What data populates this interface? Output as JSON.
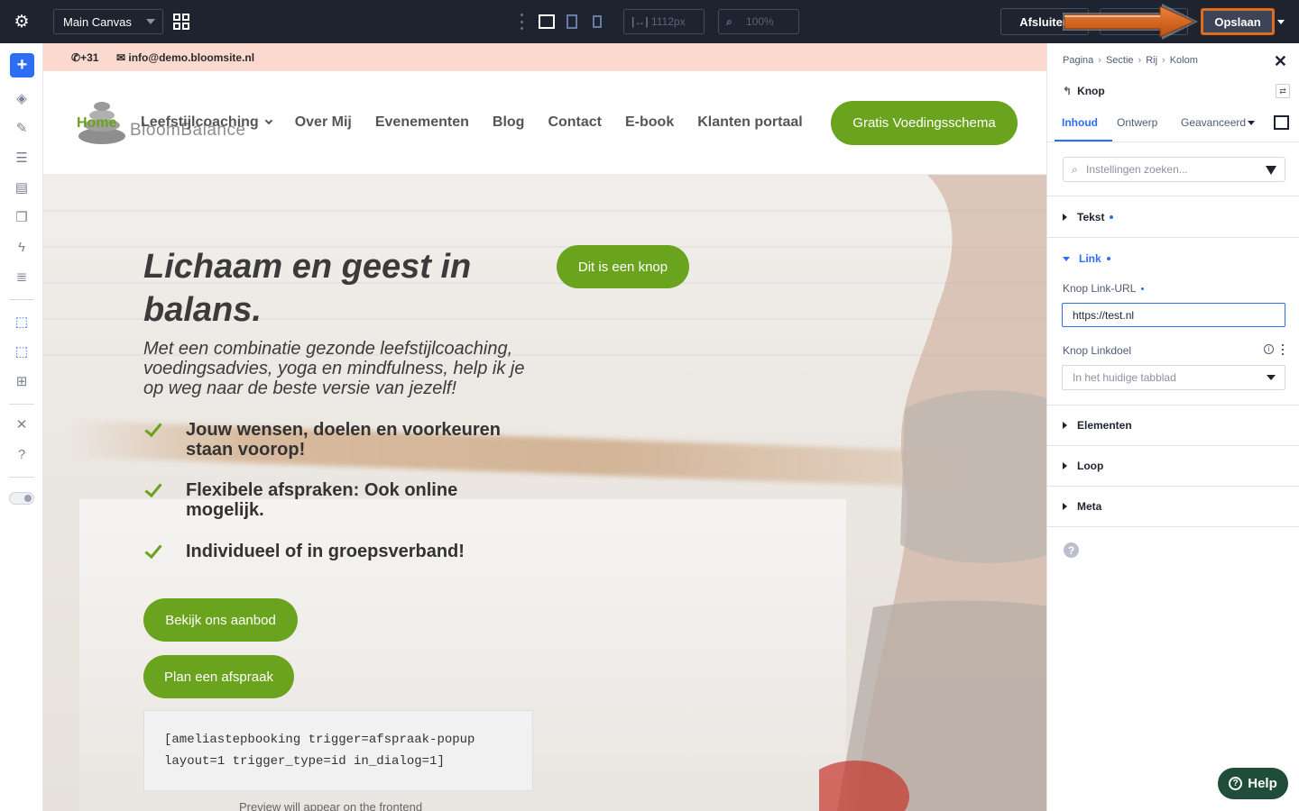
{
  "topbar": {
    "canvas_select": "Main Canvas",
    "width_value": "1112px",
    "zoom_value": "100%",
    "afsluiten_label": "Afsluiten",
    "voorbeeld_label": "Voorbeeld",
    "opslaan_label": "Opslaan",
    "highlight_color": "#e36c1b"
  },
  "leftbar": {
    "icons": [
      "add-icon",
      "layers-icon",
      "brush-icon",
      "database-icon",
      "form-icon",
      "pages-icon",
      "lightning-icon",
      "template-icon",
      "element-select-icon",
      "element-select-alt-icon",
      "query-icon",
      "tools-icon",
      "help-icon",
      "theme-toggle"
    ]
  },
  "site": {
    "phone": "+31",
    "email": "info@demo.bloomsite.nl",
    "brand": "BloomBalance",
    "nav": {
      "home": "Home",
      "items": [
        "Leefstijlcoaching",
        "Over Mij",
        "Evenementen",
        "Blog",
        "Contact",
        "E-book",
        "Klanten portaal"
      ]
    },
    "cta": "Gratis Voedingsschema",
    "hero": {
      "title": "Lichaam en geest in balans.",
      "subtitle": "Met een combinatie gezonde leefstijlcoaching, voedingsadvies, yoga en mindfulness, help ik je op weg naar de beste versie van jezelf!",
      "checks": [
        "Jouw wensen, doelen en voorkeuren staan voorop!",
        "Flexibele afspraken: Ook online mogelijk.",
        "Individueel of in groepsverband!"
      ],
      "knop_button": "Dit is een knop",
      "aanbod_button": "Bekijk ons aanbod",
      "afspraak_button": "Plan een afspraak",
      "shortcode_line1": "[ameliastepbooking trigger=afspraak-popup",
      "shortcode_line2": "layout=1 trigger_type=id in_dialog=1]",
      "preview_note": "Preview will appear on the frontend"
    },
    "accent_color": "#6aa31e"
  },
  "panel": {
    "breadcrumb": [
      "Pagina",
      "Sectie",
      "Rij",
      "Kolom"
    ],
    "element_title": "Knop",
    "tabs": [
      "Inhoud",
      "Ontwerp",
      "Geavanceerd"
    ],
    "search_placeholder": "Instellingen zoeken...",
    "sections": {
      "tekst": "Tekst",
      "link": "Link",
      "elementen": "Elementen",
      "loop": "Loop",
      "meta": "Meta"
    },
    "link_url_label": "Knop Link-URL",
    "link_url_value": "https://test.nl",
    "link_target_label": "Knop Linkdoel",
    "link_target_value": "In het huidige tabblad",
    "accent_color": "#2d6ef5"
  },
  "help_button": "Help"
}
